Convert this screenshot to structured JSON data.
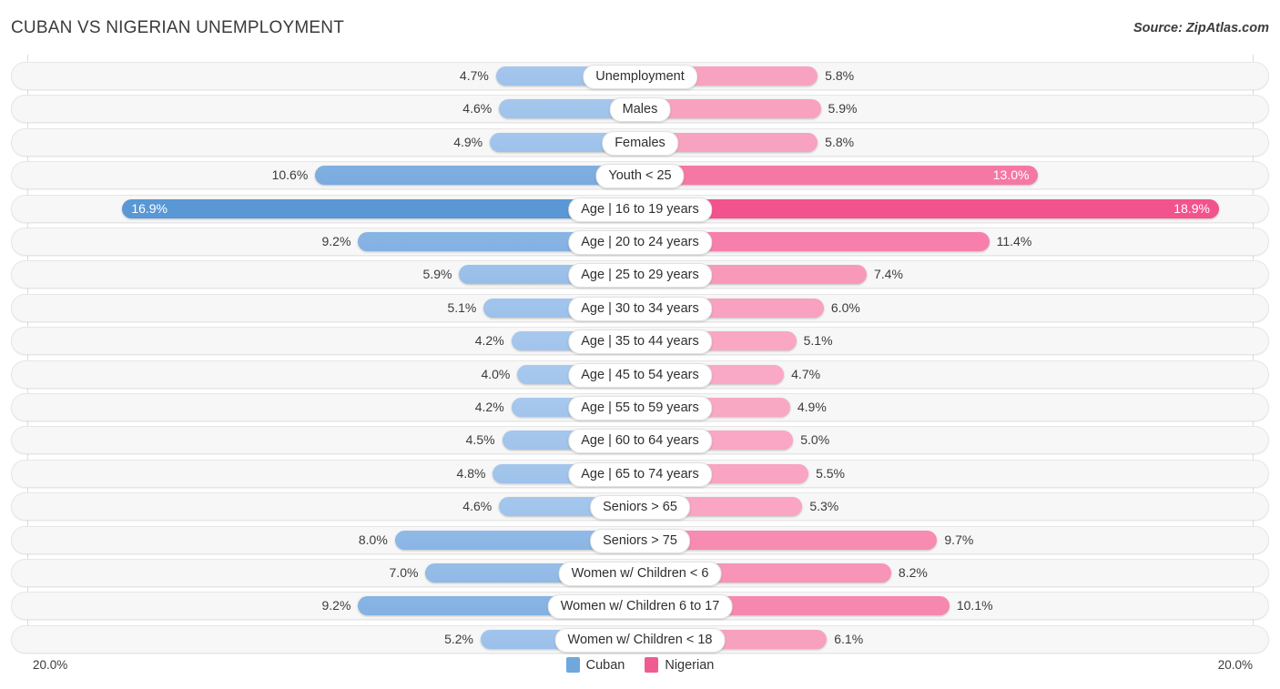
{
  "header": {
    "title": "CUBAN VS NIGERIAN UNEMPLOYMENT",
    "source": "Source: ZipAtlas.com"
  },
  "axis": {
    "left_label": "20.0%",
    "right_label": "20.0%",
    "max": 20.0
  },
  "legend": {
    "items": [
      {
        "label": "Cuban",
        "color": "#6ea8dd"
      },
      {
        "label": "Nigerian",
        "color": "#ef5c92"
      }
    ]
  },
  "colors": {
    "left_min": "#a9c9ee",
    "left_max": "#5a97d5",
    "right_min": "#f9a9c5",
    "right_max": "#f2538d",
    "row_bg": "#f7f7f7",
    "row_border": "#e6e6e6",
    "gridline": "#dcdcdc",
    "text": "#3b3b3b"
  },
  "chart_data": {
    "type": "bar",
    "title": "CUBAN VS NIGERIAN UNEMPLOYMENT",
    "subtitle": "Source: ZipAtlas.com",
    "orientation": "horizontal-diverging",
    "xlabel": "",
    "ylabel": "",
    "xlim": [
      20.0,
      20.0
    ],
    "unit": "%",
    "grid": true,
    "legend_position": "bottom-center",
    "categories": [
      "Unemployment",
      "Males",
      "Females",
      "Youth < 25",
      "Age | 16 to 19 years",
      "Age | 20 to 24 years",
      "Age | 25 to 29 years",
      "Age | 30 to 34 years",
      "Age | 35 to 44 years",
      "Age | 45 to 54 years",
      "Age | 55 to 59 years",
      "Age | 60 to 64 years",
      "Age | 65 to 74 years",
      "Seniors > 65",
      "Seniors > 75",
      "Women w/ Children < 6",
      "Women w/ Children 6 to 17",
      "Women w/ Children < 18"
    ],
    "series": [
      {
        "name": "Cuban",
        "side": "left",
        "color": "#6ea8dd",
        "values": [
          4.7,
          4.6,
          4.9,
          10.6,
          16.9,
          9.2,
          5.9,
          5.1,
          4.2,
          4.0,
          4.2,
          4.5,
          4.8,
          4.6,
          8.0,
          7.0,
          9.2,
          5.2
        ],
        "labels": [
          "4.7%",
          "4.6%",
          "4.9%",
          "10.6%",
          "16.9%",
          "9.2%",
          "5.9%",
          "5.1%",
          "4.2%",
          "4.0%",
          "4.2%",
          "4.5%",
          "4.8%",
          "4.6%",
          "8.0%",
          "7.0%",
          "9.2%",
          "5.2%"
        ]
      },
      {
        "name": "Nigerian",
        "side": "right",
        "color": "#ef5c92",
        "values": [
          5.8,
          5.9,
          5.8,
          13.0,
          18.9,
          11.4,
          7.4,
          6.0,
          5.1,
          4.7,
          4.9,
          5.0,
          5.5,
          5.3,
          9.7,
          8.2,
          10.1,
          6.1
        ],
        "labels": [
          "5.8%",
          "5.9%",
          "5.8%",
          "13.0%",
          "18.9%",
          "11.4%",
          "7.4%",
          "6.0%",
          "5.1%",
          "4.7%",
          "4.9%",
          "5.0%",
          "5.5%",
          "5.3%",
          "9.7%",
          "8.2%",
          "10.1%",
          "6.1%"
        ]
      }
    ]
  }
}
